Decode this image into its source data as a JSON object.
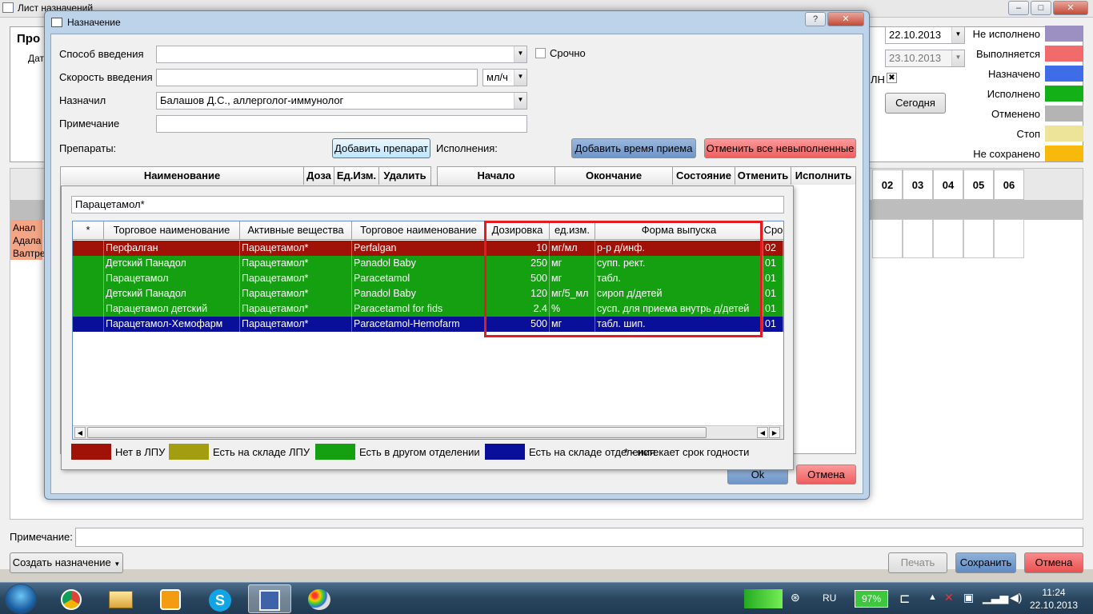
{
  "main_window": {
    "title": "Лист назначений",
    "controls": [
      "–",
      "□",
      "✕"
    ]
  },
  "left_panel": {
    "heading": "Про",
    "date_label": "Дат",
    "drugs": [
      "Анал",
      "Адала",
      "Валтре"
    ]
  },
  "right_panel": {
    "date_from": "22.10.2013",
    "date_to": "23.10.2013",
    "check_label": "ЛН",
    "today_button": "Сегодня",
    "status_legend": [
      {
        "label": "Не исполнено",
        "color": "#9c8fc2"
      },
      {
        "label": "Выполняется",
        "color": "#f26b6b"
      },
      {
        "label": "Назначено",
        "color": "#3f6de8"
      },
      {
        "label": "Исполнено",
        "color": "#13b018"
      },
      {
        "label": "Отменено",
        "color": "#b4b4b4"
      },
      {
        "label": "Стоп",
        "color": "#ede499"
      },
      {
        "label": "Не сохранено",
        "color": "#f9b80c"
      }
    ],
    "hours": [
      "02",
      "03",
      "04",
      "05",
      "06"
    ]
  },
  "bottom": {
    "note_label": "Примечание:",
    "create_button": "Создать назначение",
    "print_button": "Печать",
    "save_button": "Сохранить",
    "cancel_button": "Отмена"
  },
  "dialog": {
    "title": "Назначение",
    "help": "?",
    "close": "✕",
    "route_label": "Способ введения",
    "route_value": "",
    "urgent_label": "Срочно",
    "speed_label": "Скорость введения",
    "speed_value": "",
    "speed_unit": "мл/ч",
    "prescriber_label": "Назначил",
    "prescriber_value": "Балашов Д.С., аллерголог-иммунолог",
    "note_label": "Примечание",
    "note_value": "",
    "drugs_label": "Препараты:",
    "add_drug_button": "Добавить препарат",
    "executions_label": "Исполнения:",
    "add_time_button": "Добавить время приема",
    "cancel_all_button": "Отменить все невыполненные",
    "drugs_columns": [
      "Наименование",
      "Доза",
      "Ед.Изм.",
      "Удалить"
    ],
    "exec_columns": [
      "Начало",
      "Окончание",
      "Состояние",
      "Отменить",
      "Исполнить"
    ],
    "ok_button": "Ok",
    "cancel_button": "Отмена"
  },
  "popup": {
    "search_value": "Парацетамол*",
    "columns": [
      "*",
      "Торговое наименование",
      "Активные вещества",
      "Торговое наименование",
      "Дозировка",
      "ед.изм.",
      "Форма выпуска",
      "Сро"
    ],
    "rows": [
      {
        "star": "",
        "trade_ru": "Перфалган",
        "active": "Парацетамол*",
        "trade_en": "Perfalgan",
        "dose": "10",
        "unit": "мг/мл",
        "form": "р-р д/инф.",
        "term": "02",
        "color": "#a01208"
      },
      {
        "star": "",
        "trade_ru": "Детский Панадол",
        "active": "Парацетамол*",
        "trade_en": "Panadol Baby",
        "dose": "250",
        "unit": "мг",
        "form": "супп. рект.",
        "term": "01",
        "color": "#15a012"
      },
      {
        "star": "",
        "trade_ru": "Парацетамол",
        "active": "Парацетамол*",
        "trade_en": "Paracetamol",
        "dose": "500",
        "unit": "мг",
        "form": "табл.",
        "term": "01",
        "color": "#15a012"
      },
      {
        "star": "",
        "trade_ru": "Детский Панадол",
        "active": "Парацетамол*",
        "trade_en": "Panadol Baby",
        "dose": "120",
        "unit": "мг/5_мл",
        "form": "сироп д/детей",
        "term": "01",
        "color": "#15a012"
      },
      {
        "star": "",
        "trade_ru": "Парацетамол детский",
        "active": "Парацетамол*",
        "trade_en": "Paracetamol for fids",
        "dose": "2.4",
        "unit": "%",
        "form": "сусп. для приема внутрь д/детей",
        "term": "01",
        "color": "#15a012"
      },
      {
        "star": "",
        "trade_ru": "Парацетамол-Хемофарм",
        "active": "Парацетамол*",
        "trade_en": "Paracetamol-Hemofarm",
        "dose": "500",
        "unit": "мг",
        "form": "табл. шип.",
        "term": "01",
        "color": "#0a0f99"
      }
    ],
    "legend": [
      {
        "label": "Нет в ЛПУ",
        "color": "#a01208"
      },
      {
        "label": "Есть на складе ЛПУ",
        "color": "#a39d12"
      },
      {
        "label": "Есть в другом отделении",
        "color": "#15a012"
      },
      {
        "label": "Есть на складе отделения",
        "color": "#0a0f99"
      }
    ],
    "legend_note": "* - истекает срок годности"
  },
  "taskbar": {
    "lang": "RU",
    "battery": "97%",
    "time": "11:24",
    "date": "22.10.2013"
  }
}
